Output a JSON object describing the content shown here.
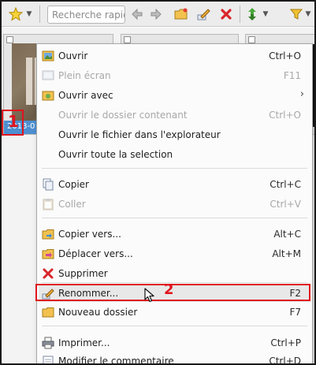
{
  "toolbar": {
    "search_placeholder": "Recherche rapide"
  },
  "thumbnail": {
    "caption": "2013-0",
    "marker": "1"
  },
  "menu": {
    "items": [
      {
        "label": "Ouvrir",
        "shortcut": "Ctrl+O",
        "icon": "open-image-icon"
      },
      {
        "label": "Plein écran",
        "shortcut": "F11",
        "icon": "fullscreen-icon"
      },
      {
        "label": "Ouvrir avec",
        "shortcut": "",
        "icon": "open-with-icon"
      },
      {
        "label": "Ouvrir le dossier contenant",
        "shortcut": "Ctrl+O"
      },
      {
        "label": "Ouvrir le fichier dans l'explorateur",
        "shortcut": ""
      },
      {
        "label": "Ouvrir toute la selection",
        "shortcut": ""
      },
      {
        "label": "Copier",
        "shortcut": "Ctrl+C",
        "icon": "copy-icon"
      },
      {
        "label": "Coller",
        "shortcut": "Ctrl+V",
        "icon": "paste-icon"
      },
      {
        "label": "Copier vers...",
        "shortcut": "Alt+C",
        "icon": "copy-to-icon"
      },
      {
        "label": "Déplacer vers...",
        "shortcut": "Alt+M",
        "icon": "move-to-icon"
      },
      {
        "label": "Supprimer",
        "shortcut": "",
        "icon": "delete-icon"
      },
      {
        "label": "Renommer...",
        "shortcut": "F2",
        "icon": "rename-icon"
      },
      {
        "label": "Nouveau dossier",
        "shortcut": "F7",
        "icon": "new-folder-icon"
      },
      {
        "label": "Imprimer...",
        "shortcut": "Ctrl+P",
        "icon": "print-icon"
      },
      {
        "label": "Modifier le commentaire",
        "shortcut": "Ctrl+D",
        "icon": "comment-icon"
      }
    ],
    "submenu_arrow": "›",
    "annotation_marker": "2"
  },
  "colors": {
    "accent": "#e0141e",
    "selection_caption": "#4d8fd0"
  }
}
